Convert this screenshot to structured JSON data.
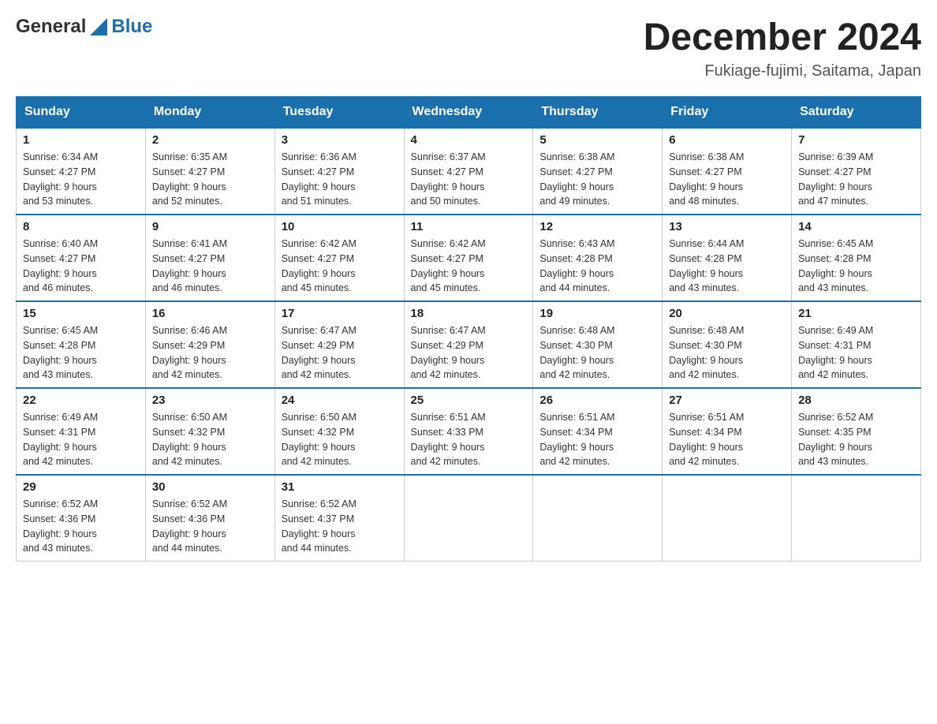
{
  "header": {
    "logo_general": "General",
    "logo_blue": "Blue",
    "month": "December 2024",
    "location": "Fukiage-fujimi, Saitama, Japan"
  },
  "days_of_week": [
    "Sunday",
    "Monday",
    "Tuesday",
    "Wednesday",
    "Thursday",
    "Friday",
    "Saturday"
  ],
  "weeks": [
    [
      {
        "day": "1",
        "sunrise": "6:34 AM",
        "sunset": "4:27 PM",
        "daylight": "9 hours and 53 minutes."
      },
      {
        "day": "2",
        "sunrise": "6:35 AM",
        "sunset": "4:27 PM",
        "daylight": "9 hours and 52 minutes."
      },
      {
        "day": "3",
        "sunrise": "6:36 AM",
        "sunset": "4:27 PM",
        "daylight": "9 hours and 51 minutes."
      },
      {
        "day": "4",
        "sunrise": "6:37 AM",
        "sunset": "4:27 PM",
        "daylight": "9 hours and 50 minutes."
      },
      {
        "day": "5",
        "sunrise": "6:38 AM",
        "sunset": "4:27 PM",
        "daylight": "9 hours and 49 minutes."
      },
      {
        "day": "6",
        "sunrise": "6:38 AM",
        "sunset": "4:27 PM",
        "daylight": "9 hours and 48 minutes."
      },
      {
        "day": "7",
        "sunrise": "6:39 AM",
        "sunset": "4:27 PM",
        "daylight": "9 hours and 47 minutes."
      }
    ],
    [
      {
        "day": "8",
        "sunrise": "6:40 AM",
        "sunset": "4:27 PM",
        "daylight": "9 hours and 46 minutes."
      },
      {
        "day": "9",
        "sunrise": "6:41 AM",
        "sunset": "4:27 PM",
        "daylight": "9 hours and 46 minutes."
      },
      {
        "day": "10",
        "sunrise": "6:42 AM",
        "sunset": "4:27 PM",
        "daylight": "9 hours and 45 minutes."
      },
      {
        "day": "11",
        "sunrise": "6:42 AM",
        "sunset": "4:27 PM",
        "daylight": "9 hours and 45 minutes."
      },
      {
        "day": "12",
        "sunrise": "6:43 AM",
        "sunset": "4:28 PM",
        "daylight": "9 hours and 44 minutes."
      },
      {
        "day": "13",
        "sunrise": "6:44 AM",
        "sunset": "4:28 PM",
        "daylight": "9 hours and 43 minutes."
      },
      {
        "day": "14",
        "sunrise": "6:45 AM",
        "sunset": "4:28 PM",
        "daylight": "9 hours and 43 minutes."
      }
    ],
    [
      {
        "day": "15",
        "sunrise": "6:45 AM",
        "sunset": "4:28 PM",
        "daylight": "9 hours and 43 minutes."
      },
      {
        "day": "16",
        "sunrise": "6:46 AM",
        "sunset": "4:29 PM",
        "daylight": "9 hours and 42 minutes."
      },
      {
        "day": "17",
        "sunrise": "6:47 AM",
        "sunset": "4:29 PM",
        "daylight": "9 hours and 42 minutes."
      },
      {
        "day": "18",
        "sunrise": "6:47 AM",
        "sunset": "4:29 PM",
        "daylight": "9 hours and 42 minutes."
      },
      {
        "day": "19",
        "sunrise": "6:48 AM",
        "sunset": "4:30 PM",
        "daylight": "9 hours and 42 minutes."
      },
      {
        "day": "20",
        "sunrise": "6:48 AM",
        "sunset": "4:30 PM",
        "daylight": "9 hours and 42 minutes."
      },
      {
        "day": "21",
        "sunrise": "6:49 AM",
        "sunset": "4:31 PM",
        "daylight": "9 hours and 42 minutes."
      }
    ],
    [
      {
        "day": "22",
        "sunrise": "6:49 AM",
        "sunset": "4:31 PM",
        "daylight": "9 hours and 42 minutes."
      },
      {
        "day": "23",
        "sunrise": "6:50 AM",
        "sunset": "4:32 PM",
        "daylight": "9 hours and 42 minutes."
      },
      {
        "day": "24",
        "sunrise": "6:50 AM",
        "sunset": "4:32 PM",
        "daylight": "9 hours and 42 minutes."
      },
      {
        "day": "25",
        "sunrise": "6:51 AM",
        "sunset": "4:33 PM",
        "daylight": "9 hours and 42 minutes."
      },
      {
        "day": "26",
        "sunrise": "6:51 AM",
        "sunset": "4:34 PM",
        "daylight": "9 hours and 42 minutes."
      },
      {
        "day": "27",
        "sunrise": "6:51 AM",
        "sunset": "4:34 PM",
        "daylight": "9 hours and 42 minutes."
      },
      {
        "day": "28",
        "sunrise": "6:52 AM",
        "sunset": "4:35 PM",
        "daylight": "9 hours and 43 minutes."
      }
    ],
    [
      {
        "day": "29",
        "sunrise": "6:52 AM",
        "sunset": "4:36 PM",
        "daylight": "9 hours and 43 minutes."
      },
      {
        "day": "30",
        "sunrise": "6:52 AM",
        "sunset": "4:36 PM",
        "daylight": "9 hours and 44 minutes."
      },
      {
        "day": "31",
        "sunrise": "6:52 AM",
        "sunset": "4:37 PM",
        "daylight": "9 hours and 44 minutes."
      },
      null,
      null,
      null,
      null
    ]
  ],
  "labels": {
    "sunrise": "Sunrise:",
    "sunset": "Sunset:",
    "daylight": "Daylight:"
  }
}
